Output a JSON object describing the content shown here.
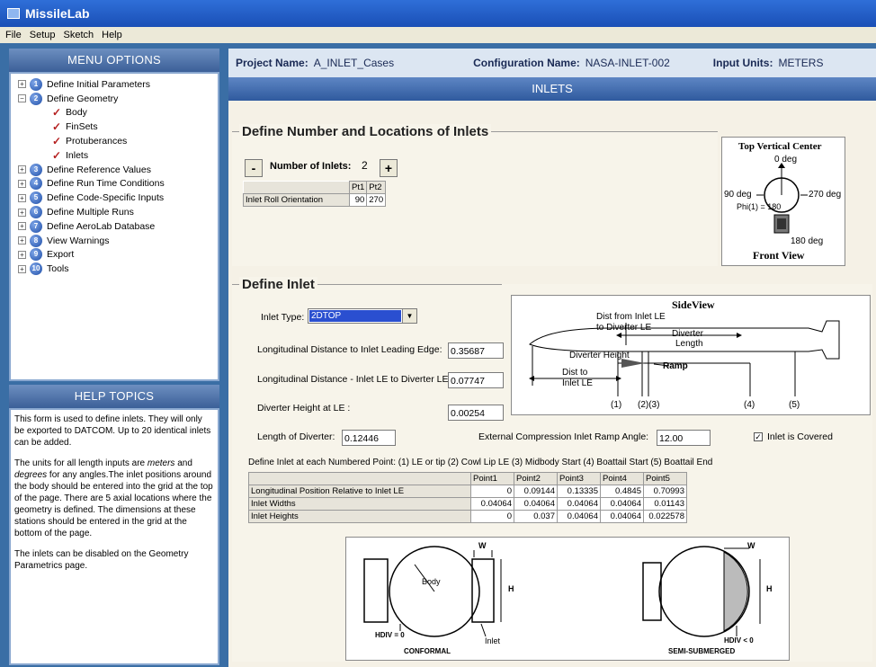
{
  "app": {
    "title": "MissileLab"
  },
  "menubar": [
    "File",
    "Setup",
    "Sketch",
    "Help"
  ],
  "menu_options": {
    "title": "MENU OPTIONS",
    "items": [
      {
        "expander": "+",
        "number": "1",
        "label": "Define Initial Parameters"
      },
      {
        "expander": "−",
        "number": "2",
        "label": "Define Geometry"
      },
      {
        "check": true,
        "label": "Body"
      },
      {
        "check": true,
        "label": "FinSets"
      },
      {
        "check": true,
        "label": "Protuberances"
      },
      {
        "check": true,
        "label": "Inlets"
      },
      {
        "expander": "+",
        "number": "3",
        "label": "Define Reference Values"
      },
      {
        "expander": "+",
        "number": "4",
        "label": "Define Run Time Conditions"
      },
      {
        "expander": "+",
        "number": "5",
        "label": "Define Code-Specific Inputs"
      },
      {
        "expander": "+",
        "number": "6",
        "label": "Define Multiple Runs"
      },
      {
        "expander": "+",
        "number": "7",
        "label": "Define AeroLab Database"
      },
      {
        "expander": "+",
        "number": "8",
        "label": "View Warnings"
      },
      {
        "expander": "+",
        "number": "9",
        "label": "Export"
      },
      {
        "expander": "+",
        "number": "10",
        "label": "Tools"
      }
    ]
  },
  "help": {
    "title": "HELP TOPICS",
    "p1": "This form is used to define inlets. They will only be exported to DATCOM. Up to 20 identical inlets can be added.",
    "p2a": "The units for all length inputs are ",
    "p2_meters": "meters",
    "p2b": " and ",
    "p2_degrees": "degrees",
    "p2c": " for any angles.The inlet positions around the body should be entered into the grid at the top of the page. There are 5 axial locations where the geometry is defined. The dimensions at these stations should be entered in the grid at the bottom of the page.",
    "p3": "The inlets can be disabled on the Geometry Parametrics page."
  },
  "project": {
    "name_label": "Project Name:",
    "name": "A_INLET_Cases",
    "config_label": "Configuration Name:",
    "config": "NASA-INLET-002",
    "units_label": "Input Units:",
    "units": "METERS"
  },
  "page_header": "INLETS",
  "number_section": {
    "title": "Define Number and Locations of Inlets",
    "minus": "-",
    "plus": "+",
    "count_label": "Number of Inlets:",
    "count": "2",
    "grid_headers": [
      "Pt1",
      "Pt2"
    ],
    "row_label": "Inlet Roll Orientation",
    "values": [
      "90",
      "270"
    ]
  },
  "front_view": {
    "title": "Top Vertical Center",
    "top": "0 deg",
    "left": "90 deg",
    "right": "270 deg",
    "phi": "Phi(1) = 180",
    "bottom": "180 deg",
    "caption": "Front View"
  },
  "inlet_section": {
    "title": "Define Inlet",
    "type_label": "Inlet Type:",
    "type_value": "2DTOP",
    "long_dist_label": "Longitudinal Distance to Inlet Leading Edge:",
    "long_dist": "0.35687",
    "le_div_label": "Longitudinal Distance - Inlet LE to Diverter LE:",
    "le_div": "0.07747",
    "div_height_label": "Diverter Height at LE :",
    "div_height": "0.00254",
    "div_length_label": "Length of Diverter:",
    "div_length": "0.12446",
    "ramp_label": "External Compression Inlet Ramp Angle:",
    "ramp": "12.00",
    "covered_label": "Inlet is Covered",
    "points_legend": "Define Inlet at each Numbered Point:  (1) LE or tip    (2) Cowl Lip LE      (3) Midbody Start      (4) Boattail Start      (5) Boattail End",
    "grid": {
      "headers": [
        "Point1",
        "Point2",
        "Point3",
        "Point4",
        "Point5"
      ],
      "rows": [
        {
          "label": "Longitudinal Position Relative to Inlet LE",
          "values": [
            "0",
            "0.09144",
            "0.13335",
            "0.4845",
            "0.70993"
          ]
        },
        {
          "label": "Inlet Widths",
          "values": [
            "0.04064",
            "0.04064",
            "0.04064",
            "0.04064",
            "0.01143"
          ]
        },
        {
          "label": "Inlet Heights",
          "values": [
            "0",
            "0.037",
            "0.04064",
            "0.04064",
            "0.022578"
          ]
        }
      ]
    }
  },
  "side_view": {
    "title": "SideView",
    "dist_le": "Dist from Inlet LE",
    "to_div": "to Diverter LE",
    "div_len1": "Diverter",
    "div_len2": "Length",
    "div_height": "Diverter Height",
    "ramp": "Ramp",
    "dist_to1": "Dist to",
    "dist_to2": "Inlet LE",
    "p1": "(1)",
    "p23": "(2)(3)",
    "p4": "(4)",
    "p5": "(5)"
  },
  "bottom_diagram": {
    "w": "W",
    "h": "H",
    "body": "Body",
    "hdiv0": "HDIV = 0",
    "inlet": "Inlet",
    "conformal": "CONFORMAL",
    "hdiv_lt": "HDIV < 0",
    "semi": "SEMI-SUBMERGED"
  }
}
